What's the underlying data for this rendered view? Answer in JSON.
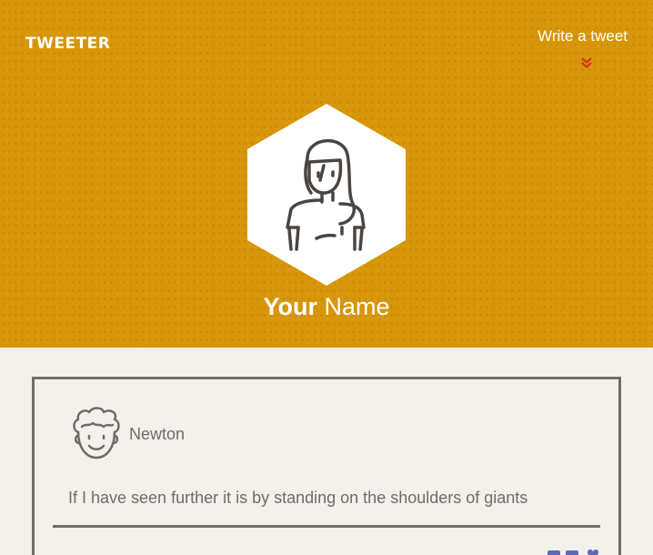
{
  "header": {
    "logo": "TWEETER",
    "write_link": "Write a tweet",
    "chevron_icon": "chevron-double-down-icon",
    "accent_color": "#d8960a"
  },
  "profile": {
    "avatar_icon": "woman-avatar-icon",
    "name_first": "Your",
    "name_last": "Name"
  },
  "tweet": {
    "avatar_icon": "curly-hair-man-avatar-icon",
    "author": "Newton",
    "text": "If I have seen further it is by standing on the shoulders of giants"
  },
  "colors": {
    "background": "#f4f1ed",
    "text": "#6f6b66",
    "border": "#716d68",
    "chevron": "#d62a1a"
  }
}
